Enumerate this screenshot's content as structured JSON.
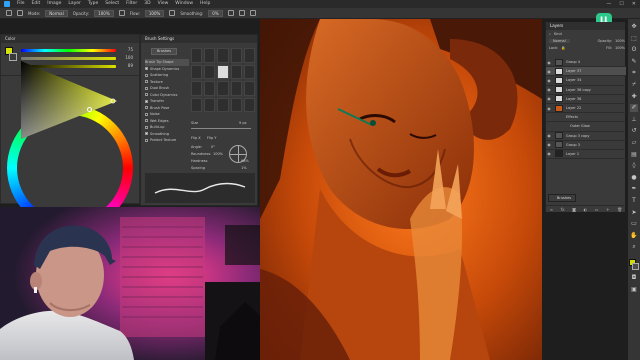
{
  "menu": {
    "items": [
      "File",
      "Edit",
      "Image",
      "Layer",
      "Type",
      "Select",
      "Filter",
      "3D",
      "View",
      "Window",
      "Help"
    ],
    "window_controls": [
      "—",
      "☐",
      "✕"
    ]
  },
  "options_bar": {
    "mode_label": "Mode:",
    "mode_value": "Normal",
    "opacity_label": "Opacity:",
    "opacity_value": "100%",
    "flow_label": "Flow:",
    "flow_value": "100%",
    "smoothing_label": "Smoothing:",
    "smoothing_value": "0%"
  },
  "color_panel": {
    "title": "Color",
    "fg_color": "#d8e200",
    "bg_color": "#3b3b3b",
    "sliders": [
      {
        "value": "75"
      },
      {
        "value": "100"
      },
      {
        "value": "89"
      }
    ]
  },
  "brush_settings": {
    "title": "Brush Settings",
    "brushes_button": "Brushes",
    "options": [
      {
        "label": "Brush Tip Shape",
        "checked": false,
        "selected": true
      },
      {
        "label": "Shape Dynamics",
        "checked": true
      },
      {
        "label": "Scattering",
        "checked": false
      },
      {
        "label": "Texture",
        "checked": false
      },
      {
        "label": "Dual Brush",
        "checked": false
      },
      {
        "label": "Color Dynamics",
        "checked": false
      },
      {
        "label": "Transfer",
        "checked": true
      },
      {
        "label": "Brush Pose",
        "checked": false
      },
      {
        "label": "Noise",
        "checked": false
      },
      {
        "label": "Wet Edges",
        "checked": false
      },
      {
        "label": "Build-up",
        "checked": false
      },
      {
        "label": "Smoothing",
        "checked": true
      },
      {
        "label": "Protect Texture",
        "checked": false
      }
    ],
    "size_label": "Size",
    "size_value": "9 px",
    "flip_x": "Flip X",
    "flip_y": "Flip Y",
    "angle_label": "Angle:",
    "angle_value": "0°",
    "roundness_label": "Roundness:",
    "roundness_value": "100%",
    "hardness_label": "Hardness",
    "hardness_value": "98%",
    "spacing_label": "Spacing",
    "spacing_value": "1%"
  },
  "layers_panel": {
    "title": "Layers",
    "search_kind": "Kind",
    "blend_mode": "Normal",
    "opacity_label": "Opacity:",
    "opacity_value": "100%",
    "lock_label": "Lock:",
    "fill_label": "Fill:",
    "fill_value": "100%",
    "layers": [
      {
        "name": "Group 4"
      },
      {
        "name": "Layer 37"
      },
      {
        "name": "Layer 34"
      },
      {
        "name": "Layer 36 copy"
      },
      {
        "name": "Layer 36"
      },
      {
        "name": "Layer 22"
      },
      {
        "name": "Effects"
      },
      {
        "name": "Outer Glow"
      },
      {
        "name": "Group 3 copy"
      },
      {
        "name": "Group 3"
      },
      {
        "name": "Layer 1"
      }
    ],
    "footer_icons": [
      "link-icon",
      "fx-icon",
      "mask-icon",
      "adjustment-icon",
      "folder-icon",
      "new-layer-icon",
      "trash-icon"
    ]
  },
  "brushes_panel_collapsed": "Brushes",
  "channel_logo": "Ц",
  "toolstrip": {
    "tools": [
      "move-tool-icon",
      "marquee-tool-icon",
      "lasso-tool-icon",
      "quick-select-icon",
      "crop-tool-icon",
      "eyedropper-icon",
      "healing-brush-icon",
      "brush-tool-icon",
      "clone-stamp-icon",
      "history-brush-icon",
      "eraser-icon",
      "gradient-icon",
      "blur-icon",
      "dodge-icon",
      "pen-tool-icon",
      "type-tool-icon",
      "path-select-icon",
      "shape-tool-icon",
      "hand-tool-icon",
      "zoom-tool-icon"
    ]
  }
}
